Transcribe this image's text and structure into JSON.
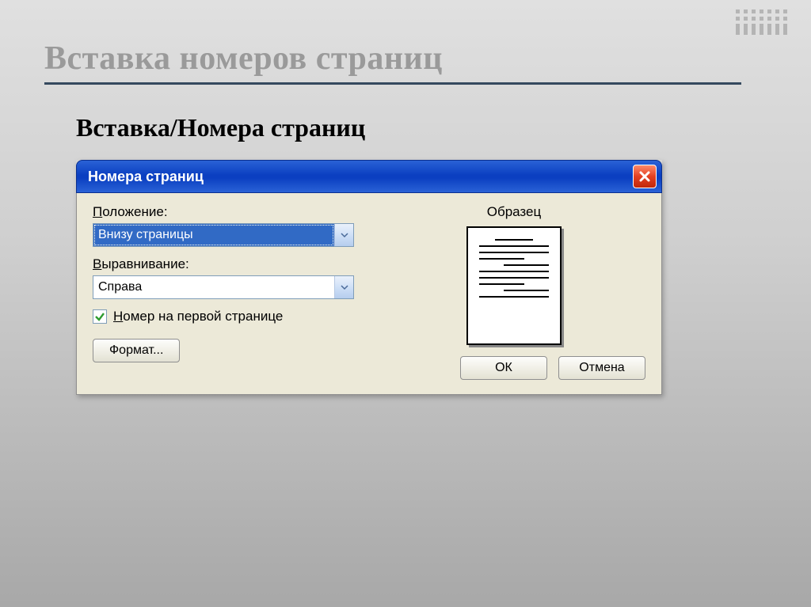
{
  "slide": {
    "heading": "Вставка номеров страниц",
    "subheading": "Вставка/Номера страниц"
  },
  "dialog": {
    "title": "Номера страниц",
    "position_label_pre": "П",
    "position_label_post": "оложение:",
    "position_value": "Внизу страницы",
    "align_label_pre": "В",
    "align_label_post": "ыравнивание:",
    "align_value": "Справа",
    "checkbox_label_pre": "Н",
    "checkbox_label_post": "омер на первой странице",
    "sample_label": "Образец",
    "format_btn": "Формат...",
    "ok_btn": "ОК",
    "cancel_btn": "Отмена"
  }
}
